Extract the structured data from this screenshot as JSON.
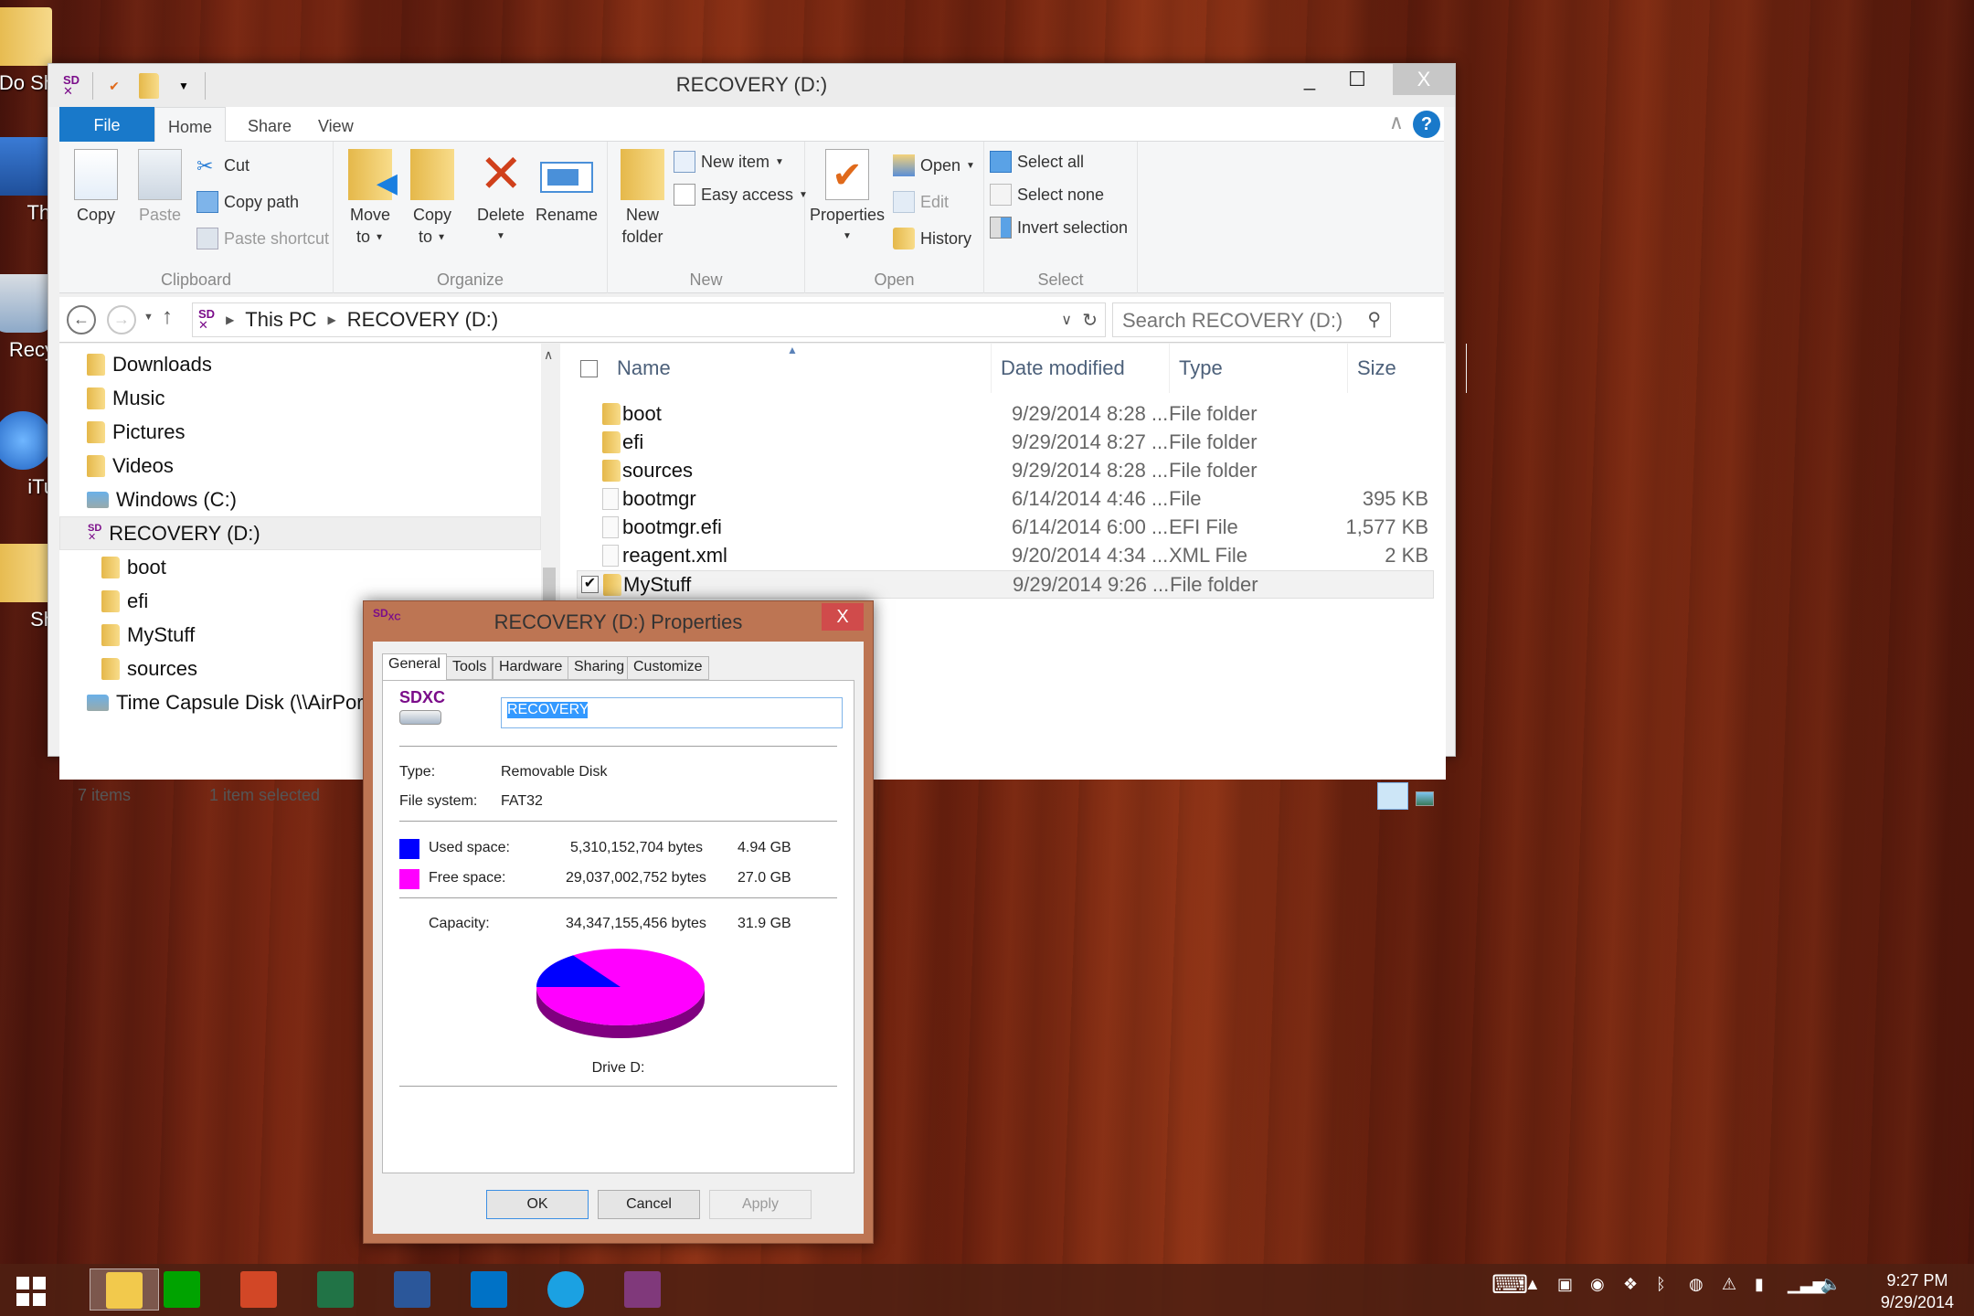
{
  "desktop": {
    "icons": [
      {
        "label": "Do Sh",
        "icon": "shared-folder-icon"
      },
      {
        "label": "Thi",
        "icon": "this-pc-icon"
      },
      {
        "label": "Recy",
        "icon": "recycle-bin-icon"
      },
      {
        "label": "iTu",
        "icon": "itunes-icon"
      },
      {
        "label": "Sh",
        "icon": "folder-icon"
      }
    ]
  },
  "explorer": {
    "title": "RECOVERY (D:)",
    "quick_access": [
      "sd-card-icon",
      "properties-icon",
      "new-folder-icon",
      "customize-qat-icon"
    ],
    "window_buttons": {
      "minimize": "_",
      "maximize": "☐",
      "close": "X"
    },
    "tabs": [
      {
        "label": "File"
      },
      {
        "label": "Home",
        "active": true
      },
      {
        "label": "Share"
      },
      {
        "label": "View"
      }
    ],
    "ribbon": {
      "clipboard": {
        "label": "Clipboard",
        "copy": "Copy",
        "paste": "Paste",
        "cut": "Cut",
        "copy_path": "Copy path",
        "paste_shortcut": "Paste shortcut"
      },
      "organize": {
        "label": "Organize",
        "move_to_1": "Move",
        "move_to_2": "to",
        "copy_to_1": "Copy",
        "copy_to_2": "to",
        "delete": "Delete",
        "rename": "Rename"
      },
      "new": {
        "label": "New",
        "new_folder_1": "New",
        "new_folder_2": "folder",
        "new_item": "New item",
        "easy_access": "Easy access"
      },
      "open": {
        "label": "Open",
        "properties": "Properties",
        "open": "Open",
        "edit": "Edit",
        "history": "History"
      },
      "select": {
        "label": "Select",
        "select_all": "Select all",
        "select_none": "Select none",
        "invert_selection": "Invert selection"
      }
    },
    "address": {
      "crumbs": [
        "This PC",
        "RECOVERY (D:)"
      ],
      "search_placeholder": "Search RECOVERY (D:)"
    },
    "nav_pane": [
      {
        "label": "Downloads",
        "indent": 1,
        "icon": "downloads-folder-icon"
      },
      {
        "label": "Music",
        "indent": 1,
        "icon": "music-folder-icon"
      },
      {
        "label": "Pictures",
        "indent": 1,
        "icon": "pictures-folder-icon"
      },
      {
        "label": "Videos",
        "indent": 1,
        "icon": "videos-folder-icon"
      },
      {
        "label": "Windows (C:)",
        "indent": 1,
        "icon": "windows-drive-icon"
      },
      {
        "label": "RECOVERY (D:)",
        "indent": 1,
        "icon": "sd-card-icon",
        "selected": true
      },
      {
        "label": "boot",
        "indent": 2,
        "icon": "folder-icon"
      },
      {
        "label": "efi",
        "indent": 2,
        "icon": "folder-icon"
      },
      {
        "label": "MyStuff",
        "indent": 2,
        "icon": "folder-icon"
      },
      {
        "label": "sources",
        "indent": 2,
        "icon": "folder-icon"
      },
      {
        "label": "Time Capsule Disk (\\\\AirPor",
        "indent": 1,
        "icon": "network-drive-icon"
      }
    ],
    "columns": {
      "name": "Name",
      "date": "Date modified",
      "type": "Type",
      "size": "Size"
    },
    "files": [
      {
        "name": "boot",
        "date": "9/29/2014 8:28 ...",
        "type": "File folder",
        "size": "",
        "kind": "folder"
      },
      {
        "name": "efi",
        "date": "9/29/2014 8:27 ...",
        "type": "File folder",
        "size": "",
        "kind": "folder"
      },
      {
        "name": "sources",
        "date": "9/29/2014 8:28 ...",
        "type": "File folder",
        "size": "",
        "kind": "folder"
      },
      {
        "name": "bootmgr",
        "date": "6/14/2014 4:46 ...",
        "type": "File",
        "size": "395 KB",
        "kind": "file"
      },
      {
        "name": "bootmgr.efi",
        "date": "6/14/2014 6:00 ...",
        "type": "EFI File",
        "size": "1,577 KB",
        "kind": "file"
      },
      {
        "name": "reagent.xml",
        "date": "9/20/2014 4:34 ...",
        "type": "XML File",
        "size": "2 KB",
        "kind": "xml"
      },
      {
        "name": "MyStuff",
        "date": "9/29/2014 9:26 ...",
        "type": "File folder",
        "size": "",
        "kind": "folder",
        "selected": true
      }
    ],
    "status": {
      "items": "7 items",
      "selected": "1 item selected"
    }
  },
  "properties_dialog": {
    "title": "RECOVERY (D:) Properties",
    "close": "X",
    "icon_label": "SDXC",
    "tabs": [
      "General",
      "Tools",
      "Hardware",
      "Sharing",
      "Customize"
    ],
    "active_tab": "General",
    "volume_name": "RECOVERY",
    "type_label": "Type:",
    "type_value": "Removable Disk",
    "fs_label": "File system:",
    "fs_value": "FAT32",
    "used_label": "Used space:",
    "used_bytes": "5,310,152,704 bytes",
    "used_gb": "4.94 GB",
    "free_label": "Free space:",
    "free_bytes": "29,037,002,752 bytes",
    "free_gb": "27.0 GB",
    "capacity_label": "Capacity:",
    "capacity_bytes": "34,347,155,456 bytes",
    "capacity_gb": "31.9 GB",
    "drive_label": "Drive D:",
    "colors": {
      "used": "#0000ff",
      "free": "#ff00ff",
      "free_side": "#800080",
      "used_side": "#00008b"
    },
    "used_fraction": 0.1546,
    "buttons": {
      "ok": "OK",
      "cancel": "Cancel",
      "apply": "Apply"
    }
  },
  "taskbar": {
    "apps": [
      {
        "name": "file-explorer",
        "active": true,
        "color": "#f2c94c"
      },
      {
        "name": "store",
        "color": "#00a300"
      },
      {
        "name": "powerpoint",
        "color": "#d24726"
      },
      {
        "name": "excel",
        "color": "#217346"
      },
      {
        "name": "word",
        "color": "#2b579a"
      },
      {
        "name": "outlook",
        "color": "#0072c6"
      },
      {
        "name": "internet-explorer",
        "color": "#1ba1e2"
      },
      {
        "name": "onenote",
        "color": "#80397b"
      }
    ],
    "tray_icons": [
      "touch-keyboard-icon",
      "show-hidden-icons-icon",
      "usb-icon",
      "teamviewer-icon",
      "dropbox-icon",
      "bluetooth-icon",
      "network-globe-icon",
      "action-center-warning-icon",
      "power-icon",
      "signal-icon",
      "volume-icon"
    ],
    "time": "9:27 PM",
    "date": "9/29/2014"
  }
}
